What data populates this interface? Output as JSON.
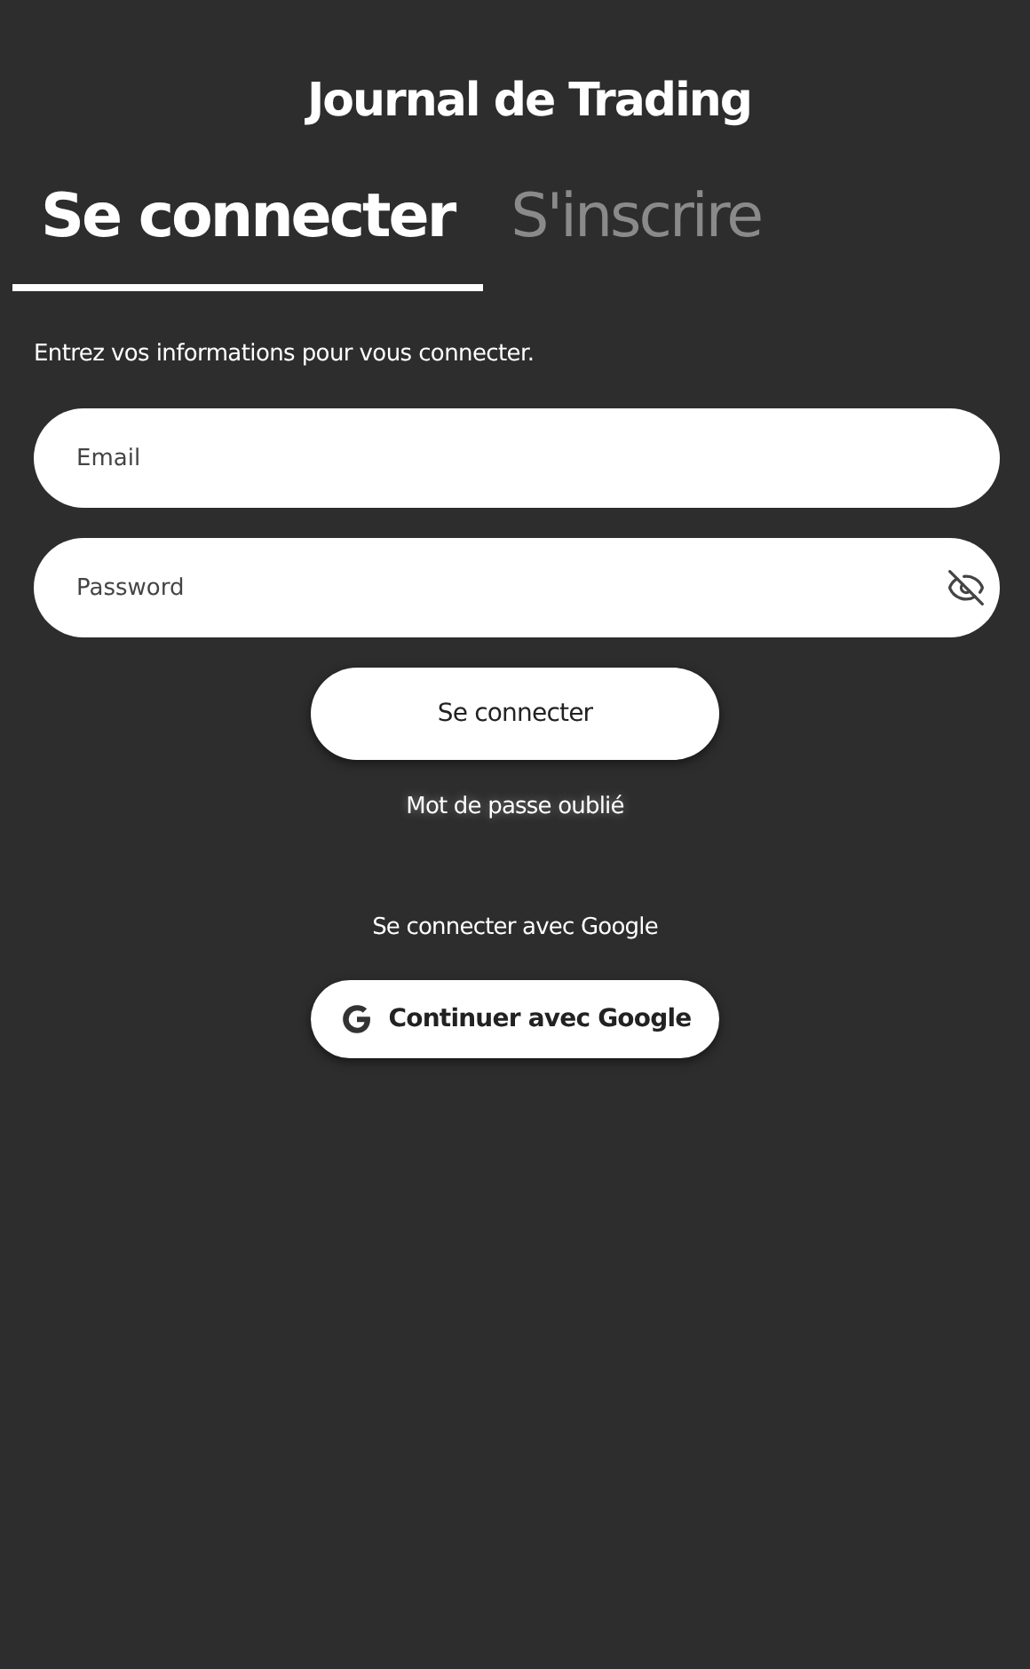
{
  "app_title": "Journal de Trading",
  "tabs": [
    {
      "label": "Se connecter",
      "selected": true
    },
    {
      "label": "S'inscrire",
      "selected": false
    }
  ],
  "intro": "Entrez vos informations pour vous connecter.",
  "fields": [
    {
      "kind": "email",
      "placeholder": "Email"
    },
    {
      "kind": "password",
      "placeholder": "Password"
    }
  ],
  "submit_button": "Se connecter",
  "forgot_link": "Mot de passe oublié",
  "google_heading": "Se connecter avec Google",
  "google_button": "Continuer avec Google"
}
